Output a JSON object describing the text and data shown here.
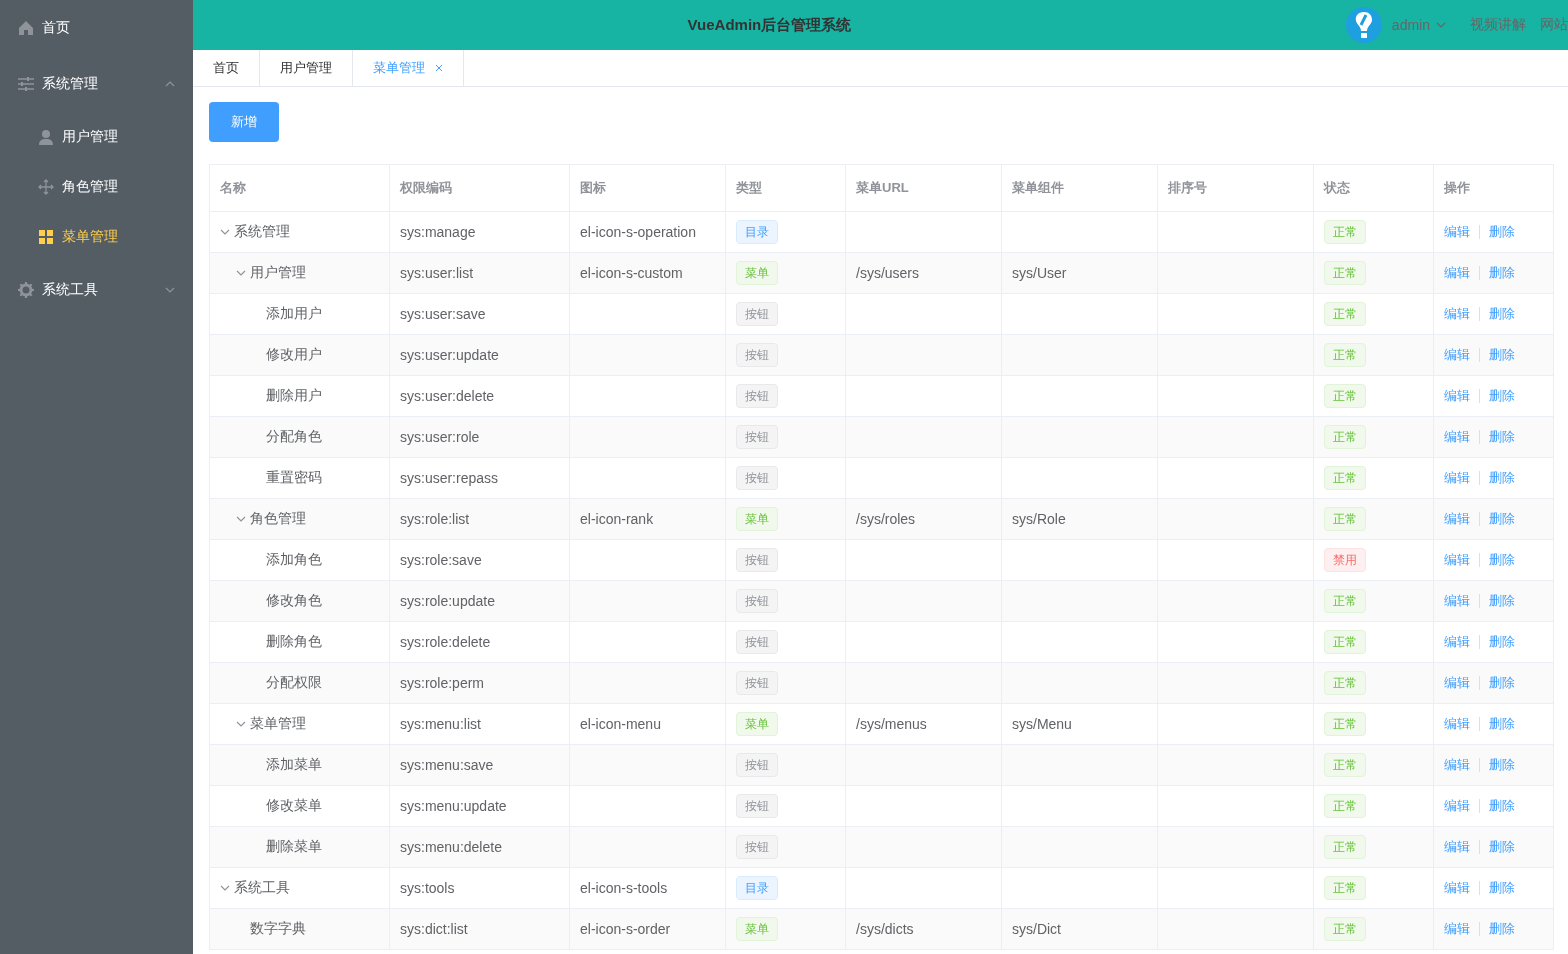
{
  "sidebar": {
    "items": [
      {
        "label": "首页",
        "selected": false
      },
      {
        "label": "系统管理",
        "selected": false,
        "expanded": true,
        "children": [
          {
            "label": "用户管理",
            "selected": false
          },
          {
            "label": "角色管理",
            "selected": false
          },
          {
            "label": "菜单管理",
            "selected": true
          }
        ]
      },
      {
        "label": "系统工具",
        "selected": false,
        "expanded": false
      }
    ]
  },
  "header": {
    "title": "VueAdmin后台管理系统",
    "user": "admin",
    "links": [
      "视频讲解",
      "网站"
    ]
  },
  "tabs": [
    {
      "label": "首页",
      "selected": false,
      "closable": false
    },
    {
      "label": "用户管理",
      "selected": false,
      "closable": false
    },
    {
      "label": "菜单管理",
      "selected": true,
      "closable": true
    }
  ],
  "add_button": "新增",
  "table": {
    "columns": [
      "名称",
      "权限编码",
      "图标",
      "类型",
      "菜单URL",
      "菜单组件",
      "排序号",
      "状态",
      "操作"
    ],
    "rows": [
      {
        "name": "系统管理",
        "perm": "sys:manage",
        "icon": "el-icon-s-operation",
        "type": {
          "kind": "dir",
          "label": "目录"
        },
        "status": {
          "kind": "normal",
          "label": "正常"
        },
        "actions": [
          "编辑",
          "删除"
        ],
        "expanded": true,
        "children": [
          {
            "name": "用户管理",
            "perm": "sys:user:list",
            "icon": "el-icon-s-custom",
            "type": {
              "kind": "menu",
              "label": "菜单"
            },
            "url": "/sys/users",
            "component": "sys/User",
            "status": {
              "kind": "normal",
              "label": "正常"
            },
            "actions": [
              "编辑",
              "删除"
            ],
            "expanded": true,
            "children": [
              {
                "name": "添加用户",
                "perm": "sys:user:save",
                "type": {
                  "kind": "button",
                  "label": "按钮"
                },
                "status": {
                  "kind": "normal",
                  "label": "正常"
                },
                "actions": [
                  "编辑",
                  "删除"
                ]
              },
              {
                "name": "修改用户",
                "perm": "sys:user:update",
                "type": {
                  "kind": "button",
                  "label": "按钮"
                },
                "status": {
                  "kind": "normal",
                  "label": "正常"
                },
                "actions": [
                  "编辑",
                  "删除"
                ]
              },
              {
                "name": "删除用户",
                "perm": "sys:user:delete",
                "type": {
                  "kind": "button",
                  "label": "按钮"
                },
                "status": {
                  "kind": "normal",
                  "label": "正常"
                },
                "actions": [
                  "编辑",
                  "删除"
                ]
              },
              {
                "name": "分配角色",
                "perm": "sys:user:role",
                "type": {
                  "kind": "button",
                  "label": "按钮"
                },
                "status": {
                  "kind": "normal",
                  "label": "正常"
                },
                "actions": [
                  "编辑",
                  "删除"
                ]
              },
              {
                "name": "重置密码",
                "perm": "sys:user:repass",
                "type": {
                  "kind": "button",
                  "label": "按钮"
                },
                "status": {
                  "kind": "normal",
                  "label": "正常"
                },
                "actions": [
                  "编辑",
                  "删除"
                ]
              }
            ]
          },
          {
            "name": "角色管理",
            "perm": "sys:role:list",
            "icon": "el-icon-rank",
            "type": {
              "kind": "menu",
              "label": "菜单"
            },
            "url": "/sys/roles",
            "component": "sys/Role",
            "status": {
              "kind": "normal",
              "label": "正常"
            },
            "actions": [
              "编辑",
              "删除"
            ],
            "expanded": true,
            "children": [
              {
                "name": "添加角色",
                "perm": "sys:role:save",
                "type": {
                  "kind": "button",
                  "label": "按钮"
                },
                "status": {
                  "kind": "disabled",
                  "label": "禁用"
                },
                "actions": [
                  "编辑",
                  "删除"
                ]
              },
              {
                "name": "修改角色",
                "perm": "sys:role:update",
                "type": {
                  "kind": "button",
                  "label": "按钮"
                },
                "status": {
                  "kind": "normal",
                  "label": "正常"
                },
                "actions": [
                  "编辑",
                  "删除"
                ]
              },
              {
                "name": "删除角色",
                "perm": "sys:role:delete",
                "type": {
                  "kind": "button",
                  "label": "按钮"
                },
                "status": {
                  "kind": "normal",
                  "label": "正常"
                },
                "actions": [
                  "编辑",
                  "删除"
                ]
              },
              {
                "name": "分配权限",
                "perm": "sys:role:perm",
                "type": {
                  "kind": "button",
                  "label": "按钮"
                },
                "status": {
                  "kind": "normal",
                  "label": "正常"
                },
                "actions": [
                  "编辑",
                  "删除"
                ]
              }
            ]
          },
          {
            "name": "菜单管理",
            "perm": "sys:menu:list",
            "icon": "el-icon-menu",
            "type": {
              "kind": "menu",
              "label": "菜单"
            },
            "url": "/sys/menus",
            "component": "sys/Menu",
            "status": {
              "kind": "normal",
              "label": "正常"
            },
            "actions": [
              "编辑",
              "删除"
            ],
            "expanded": true,
            "children": [
              {
                "name": "添加菜单",
                "perm": "sys:menu:save",
                "type": {
                  "kind": "button",
                  "label": "按钮"
                },
                "status": {
                  "kind": "normal",
                  "label": "正常"
                },
                "actions": [
                  "编辑",
                  "删除"
                ]
              },
              {
                "name": "修改菜单",
                "perm": "sys:menu:update",
                "type": {
                  "kind": "button",
                  "label": "按钮"
                },
                "status": {
                  "kind": "normal",
                  "label": "正常"
                },
                "actions": [
                  "编辑",
                  "删除"
                ]
              },
              {
                "name": "删除菜单",
                "perm": "sys:menu:delete",
                "type": {
                  "kind": "button",
                  "label": "按钮"
                },
                "status": {
                  "kind": "normal",
                  "label": "正常"
                },
                "actions": [
                  "编辑",
                  "删除"
                ]
              }
            ]
          }
        ]
      },
      {
        "name": "系统工具",
        "perm": "sys:tools",
        "icon": "el-icon-s-tools",
        "type": {
          "kind": "dir",
          "label": "目录"
        },
        "status": {
          "kind": "normal",
          "label": "正常"
        },
        "actions": [
          "编辑",
          "删除"
        ],
        "expanded": true,
        "children": [
          {
            "name": "数字字典",
            "perm": "sys:dict:list",
            "icon": "el-icon-s-order",
            "type": {
              "kind": "menu",
              "label": "菜单"
            },
            "url": "/sys/dicts",
            "component": "sys/Dict",
            "status": {
              "kind": "normal",
              "label": "正常"
            },
            "actions": [
              "编辑",
              "删除"
            ]
          }
        ]
      }
    ]
  }
}
